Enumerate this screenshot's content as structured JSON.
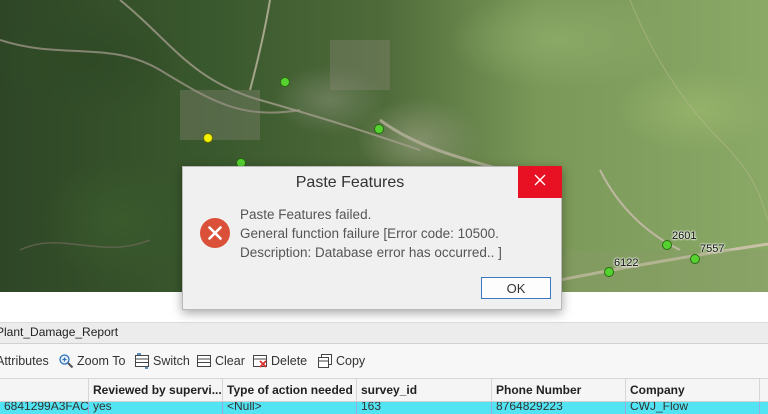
{
  "map": {
    "labels": {
      "pt_a": "2601",
      "pt_b": "7557",
      "pt_c": "6122"
    }
  },
  "dialog": {
    "title": "Paste Features",
    "close_icon": "close-icon",
    "error_icon": "error-icon",
    "message_line1": "Paste Features failed.",
    "message_line2": "General function failure [Error code: 10500.",
    "message_line3": "Description: Database error has occurred.. ]",
    "ok_label": "OK"
  },
  "table": {
    "layer_tab": "Plant_Damage_Report",
    "toolbar": {
      "attributes": "Attributes",
      "zoom_to": "Zoom To",
      "switch": "Switch",
      "clear": "Clear",
      "delete": "Delete",
      "copy": "Copy"
    },
    "columns": [
      "Reviewed by supervi...",
      "Type of action needed",
      "survey_id",
      "Phone Number",
      "Company"
    ],
    "row": {
      "globalid": "6841299A3FAC}",
      "reviewed": "yes",
      "action": "<Null>",
      "survey_id": "163",
      "phone": "8764829223",
      "company": "CWJ_Flow"
    }
  },
  "colors": {
    "selection": "#52e4f2",
    "close_red": "#e81123",
    "error_red": "#db5038",
    "point_green": "#55d230",
    "point_yellow": "#f2f200"
  }
}
